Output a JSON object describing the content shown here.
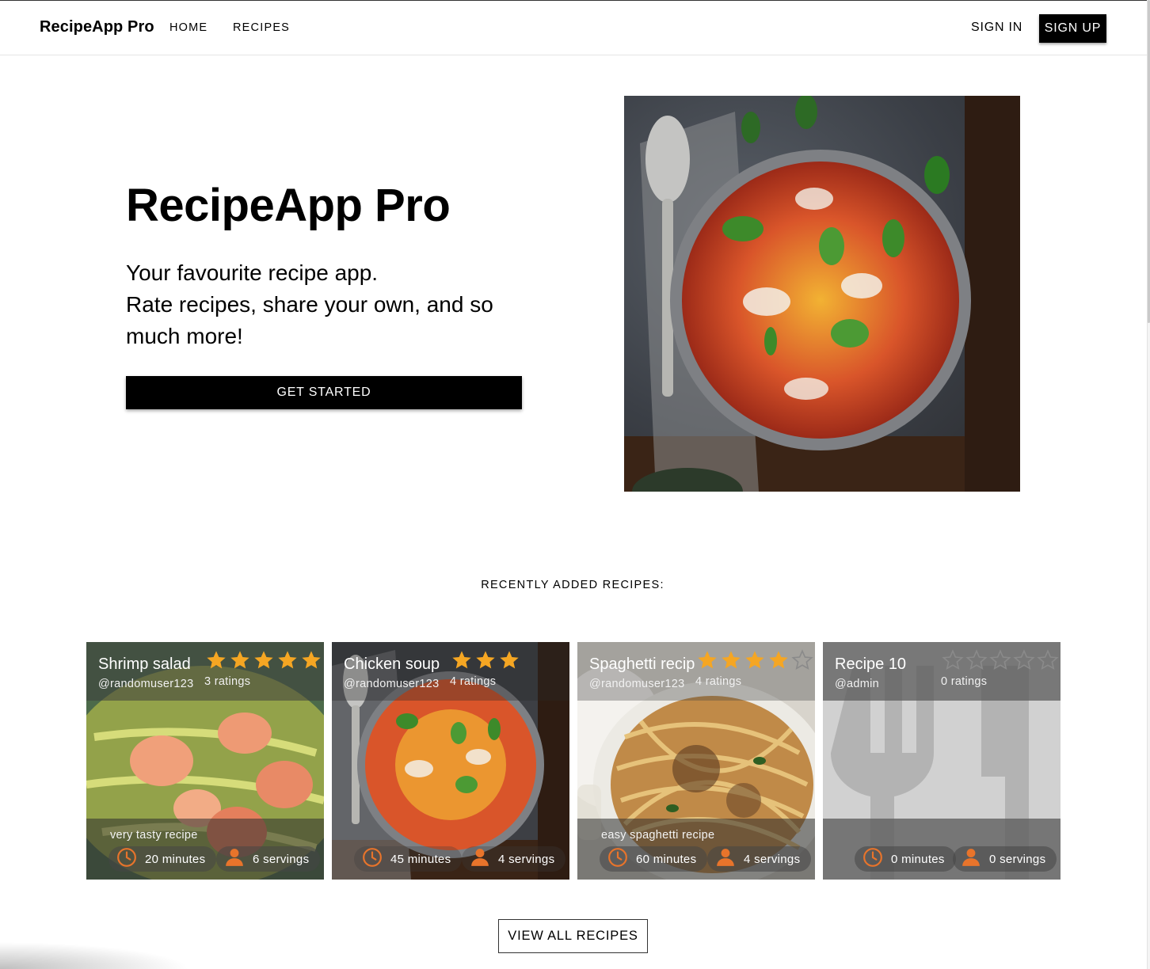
{
  "header": {
    "brand": "RecipeApp Pro",
    "nav": [
      "HOME",
      "RECIPES"
    ],
    "sign_in": "SIGN IN",
    "sign_up": "SIGN UP"
  },
  "hero": {
    "title": "RecipeApp Pro",
    "subtitle_line1": "Your favourite recipe app.",
    "subtitle_line2": "Rate recipes, share your own, and so much more!",
    "cta": "GET STARTED"
  },
  "section": {
    "title": "RECENTLY ADDED RECIPES:",
    "view_all": "VIEW ALL RECIPES"
  },
  "recipes": [
    {
      "title": "Shrimp salad",
      "author": "@randomuser123",
      "ratings": "3 ratings",
      "stars": 5,
      "description": "very tasty recipe",
      "time": "20 minutes",
      "servings": "6 servings"
    },
    {
      "title": "Chicken soup",
      "author": "@randomuser123",
      "ratings": "4 ratings",
      "stars": 3,
      "description": "",
      "time": "45 minutes",
      "servings": "4 servings"
    },
    {
      "title": "Spaghetti recip",
      "author": "@randomuser123",
      "ratings": "4 ratings",
      "stars": 4,
      "description": "easy spaghetti recipe",
      "time": "60 minutes",
      "servings": "4 servings"
    },
    {
      "title": "Recipe 10",
      "author": "@admin",
      "ratings": "0 ratings",
      "stars": 0,
      "description": "",
      "time": "0 minutes",
      "servings": "0 servings"
    }
  ],
  "icons": {
    "star": "star-icon",
    "clock": "clock-icon",
    "person": "person-icon",
    "placeholder": "fork-knife-icon"
  },
  "colors": {
    "star_filled": "#f5a623",
    "accent_orange": "#e8742b",
    "primary": "#000000"
  }
}
